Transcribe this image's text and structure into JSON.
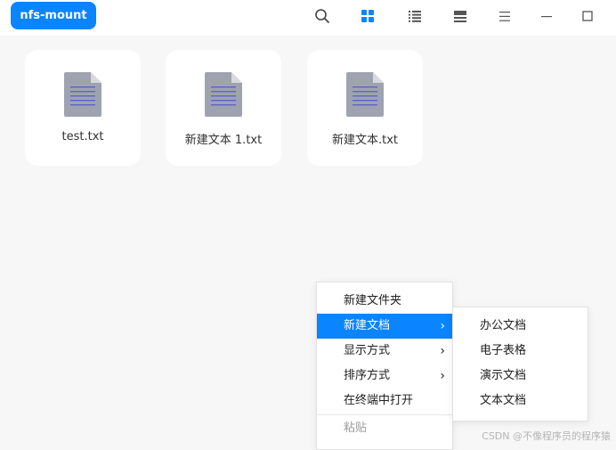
{
  "header": {
    "path_button": "nfs-mount",
    "icons": [
      "search-icon",
      "icon-view-icon",
      "list-view-icon",
      "tree-view-icon",
      "menu-icon",
      "minimize-icon",
      "maximize-icon"
    ]
  },
  "files": [
    {
      "name": "test.txt"
    },
    {
      "name": "新建文本 1.txt"
    },
    {
      "name": "新建文本.txt"
    }
  ],
  "context_menu": {
    "items": [
      {
        "label": "新建文件夹"
      },
      {
        "label": "新建文档",
        "submenu": true,
        "active": true
      },
      {
        "label": "显示方式",
        "submenu": true
      },
      {
        "label": "排序方式",
        "submenu": true
      },
      {
        "label": "在终端中打开"
      },
      {
        "label": "粘贴",
        "disabled": true
      }
    ]
  },
  "submenu": {
    "items": [
      {
        "label": "办公文档"
      },
      {
        "label": "电子表格"
      },
      {
        "label": "演示文档"
      },
      {
        "label": "文本文档"
      }
    ]
  },
  "watermark": "CSDN @不像程序员的程序猿",
  "colors": {
    "accent": "#0a84ff",
    "background": "#f7f7f7",
    "card": "#ffffff"
  }
}
